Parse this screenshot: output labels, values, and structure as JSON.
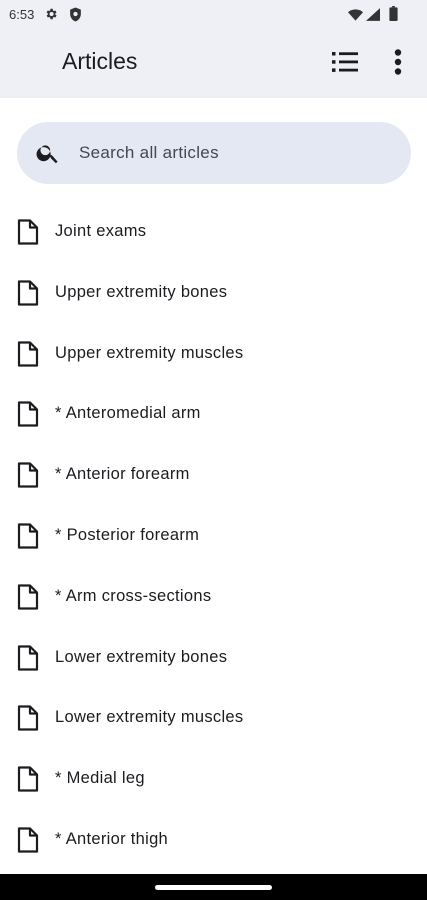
{
  "status_bar": {
    "time": "6:53",
    "icons": [
      "gear-icon",
      "shield-icon",
      "wifi-icon",
      "signal-icon",
      "battery-icon"
    ]
  },
  "app_bar": {
    "title": "Articles",
    "actions": [
      "list-view-icon",
      "more-vert-icon"
    ]
  },
  "search": {
    "placeholder": "Search all articles",
    "value": ""
  },
  "articles": [
    {
      "label": "Joint exams",
      "icon": "document-icon"
    },
    {
      "label": "Upper extremity bones",
      "icon": "document-icon"
    },
    {
      "label": "Upper extremity muscles",
      "icon": "document-icon"
    },
    {
      "label": "* Anteromedial arm",
      "icon": "document-icon"
    },
    {
      "label": "* Anterior forearm",
      "icon": "document-icon"
    },
    {
      "label": "* Posterior forearm",
      "icon": "document-icon"
    },
    {
      "label": "* Arm cross-sections",
      "icon": "document-icon"
    },
    {
      "label": "Lower extremity bones",
      "icon": "document-icon"
    },
    {
      "label": "Lower extremity muscles",
      "icon": "document-icon"
    },
    {
      "label": "* Medial leg",
      "icon": "document-icon"
    },
    {
      "label": "* Anterior thigh",
      "icon": "document-icon"
    }
  ],
  "colors": {
    "app_bar_bg": "#eef0f6",
    "search_bg": "#e4e8f2",
    "text": "#1c1b1f",
    "nav_bar": "#000000"
  }
}
